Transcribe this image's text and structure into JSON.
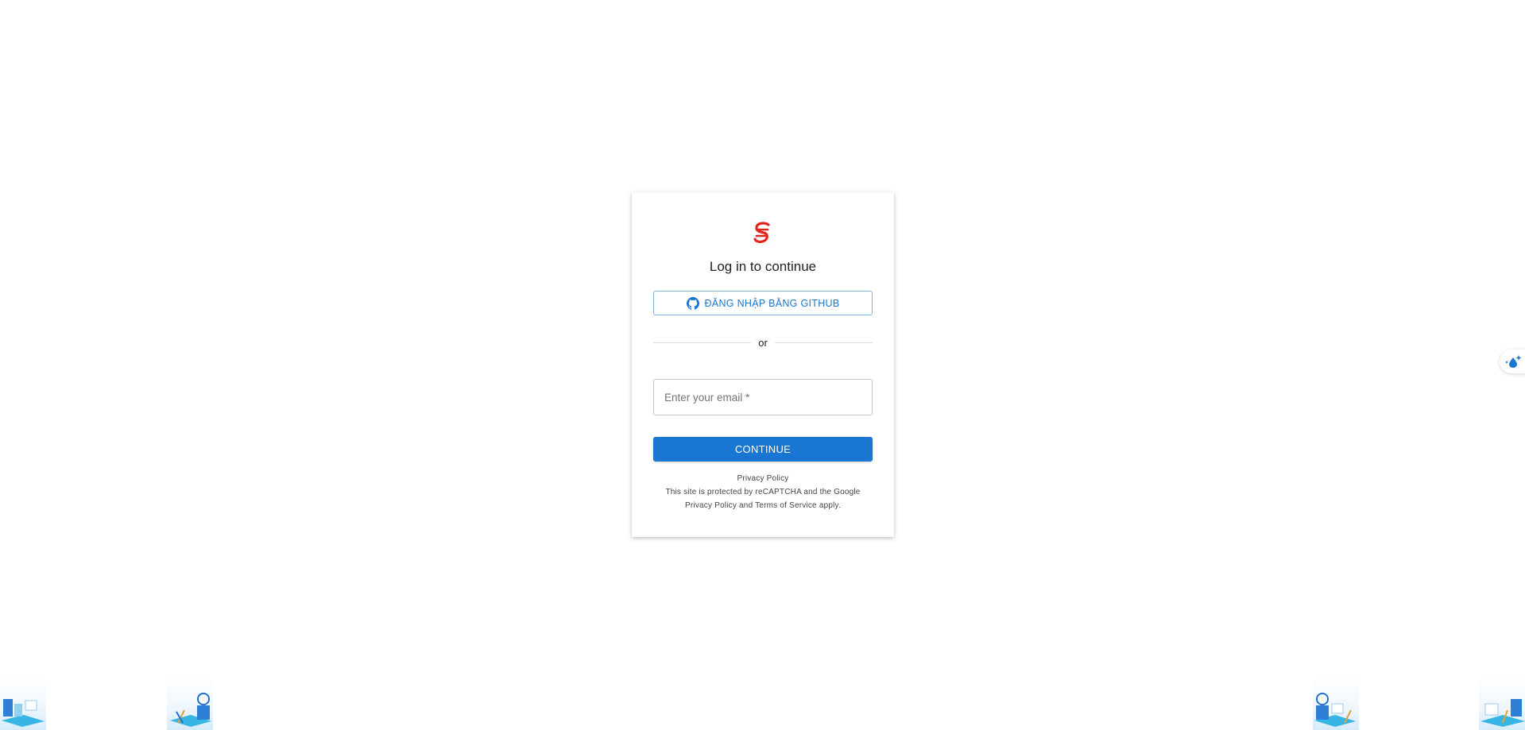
{
  "login": {
    "title": "Log in to continue",
    "github_button_label": "ĐĂNG NHẬP BẰNG GITHUB",
    "divider_text": "or",
    "email_placeholder": "Enter your email *",
    "email_value": "",
    "continue_label": "CONTINUE"
  },
  "footer": {
    "privacy_policy": "Privacy Policy",
    "recaptcha_line_prefix": "This site is protected by reCAPTCHA and the Google",
    "google_privacy_policy": "Privacy Policy",
    "and_text": "and",
    "terms_of_service": "Terms of Service",
    "apply_text": "apply."
  },
  "colors": {
    "accent": "#1976d2",
    "brand_logo": "#e3241b"
  },
  "icons": {
    "logo": "brand-s-logo-icon",
    "github": "github-icon",
    "side_widget": "sparkle-drop-icon"
  }
}
